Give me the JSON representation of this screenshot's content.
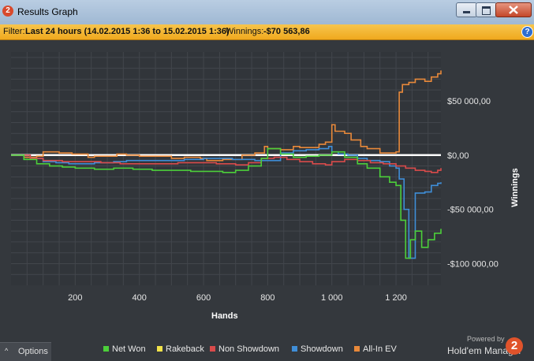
{
  "window": {
    "title": "Results Graph",
    "app_icon_glyph": "2"
  },
  "filter": {
    "label": "Filter:",
    "value": "Last 24 hours (14.02.2015 1:36 to 15.02.2015 1:36)",
    "winnings_label": "Winnings:",
    "winnings_value": "-$70 563,86",
    "help_glyph": "?"
  },
  "chart_data": {
    "type": "line",
    "xlabel": "Hands",
    "ylabel": "Winnings",
    "xlim": [
      0,
      1340
    ],
    "ylim": [
      -120000,
      95000
    ],
    "x_ticks": [
      {
        "value": 200,
        "label": "200"
      },
      {
        "value": 400,
        "label": "400"
      },
      {
        "value": 600,
        "label": "600"
      },
      {
        "value": 800,
        "label": "800"
      },
      {
        "value": 1000,
        "label": "1 000"
      },
      {
        "value": 1200,
        "label": "1 200"
      }
    ],
    "y_ticks": [
      {
        "value": 50000,
        "label": "$50 000,00"
      },
      {
        "value": 0,
        "label": "$0,00"
      },
      {
        "value": -50000,
        "label": "-$50 000,00"
      },
      {
        "value": -100000,
        "label": "-$100 000,00"
      }
    ],
    "grid": true,
    "legend_position": "bottom",
    "series": [
      {
        "name": "Rakeback",
        "color": "#f2e34a",
        "x": [
          0,
          1340
        ],
        "y": [
          0,
          0
        ]
      },
      {
        "name": "All-In EV",
        "color": "#e8893a",
        "x": [
          0,
          40,
          80,
          100,
          150,
          190,
          240,
          260,
          310,
          330,
          360,
          400,
          450,
          500,
          540,
          590,
          610,
          660,
          700,
          720,
          760,
          790,
          800,
          840,
          880,
          900,
          960,
          980,
          1000,
          1010,
          1040,
          1060,
          1090,
          1110,
          1150,
          1190,
          1200,
          1210,
          1220,
          1240,
          1260,
          1290,
          1310,
          1330,
          1340
        ],
        "y": [
          0,
          -2000,
          -1000,
          3000,
          2000,
          1000,
          -2000,
          -1000,
          -1000,
          1000,
          0,
          -1000,
          -1000,
          -3000,
          -2000,
          -3000,
          -5000,
          -4000,
          -4000,
          0,
          2000,
          8000,
          6000,
          5000,
          8000,
          7000,
          10000,
          12000,
          28000,
          22000,
          20000,
          14000,
          8000,
          6000,
          2000,
          2000,
          3000,
          58000,
          65000,
          67000,
          70000,
          68000,
          72000,
          75000,
          78000
        ]
      },
      {
        "name": "Showdown",
        "color": "#3f8ed8",
        "x": [
          0,
          60,
          100,
          140,
          180,
          220,
          260,
          290,
          320,
          360,
          400,
          450,
          500,
          540,
          600,
          640,
          690,
          720,
          760,
          800,
          840,
          880,
          920,
          960,
          990,
          1000,
          1020,
          1050,
          1080,
          1110,
          1150,
          1180,
          1200,
          1210,
          1225,
          1240,
          1260,
          1290,
          1310,
          1330,
          1340
        ],
        "y": [
          0,
          -3000,
          -6000,
          -7000,
          -8000,
          -8000,
          -7000,
          -7000,
          -6000,
          -5000,
          -5000,
          -5000,
          -5000,
          -4000,
          -3000,
          -3000,
          -4000,
          -4000,
          -5000,
          -5000,
          2000,
          4000,
          5000,
          6000,
          8000,
          3000,
          1000,
          0,
          -3000,
          -5000,
          -6000,
          -10000,
          -12000,
          -22000,
          -50000,
          -95000,
          -35000,
          -34000,
          -28000,
          -26000,
          -25000
        ]
      },
      {
        "name": "Non Showdown",
        "color": "#d94b4b",
        "x": [
          0,
          60,
          100,
          160,
          220,
          280,
          340,
          400,
          460,
          520,
          580,
          640,
          700,
          740,
          780,
          820,
          860,
          900,
          940,
          980,
          1000,
          1040,
          1080,
          1120,
          1160,
          1200,
          1230,
          1260,
          1290,
          1310,
          1330,
          1340
        ],
        "y": [
          0,
          -3000,
          -5000,
          -6000,
          -6000,
          -7000,
          -8000,
          -8000,
          -8000,
          -7000,
          -7000,
          -8000,
          -9000,
          -7000,
          -3000,
          -2000,
          -4000,
          -6000,
          -8000,
          -9000,
          -6000,
          -4000,
          -5000,
          -7000,
          -8000,
          -10000,
          -12000,
          -14000,
          -15000,
          -16000,
          -14000,
          -12000
        ]
      },
      {
        "name": "Net Won",
        "color": "#4ccf3a",
        "x": [
          0,
          40,
          80,
          120,
          160,
          200,
          260,
          320,
          380,
          440,
          500,
          560,
          620,
          660,
          700,
          740,
          780,
          800,
          840,
          880,
          920,
          960,
          1000,
          1040,
          1080,
          1110,
          1150,
          1180,
          1200,
          1215,
          1230,
          1245,
          1260,
          1280,
          1300,
          1320,
          1340
        ],
        "y": [
          0,
          -4000,
          -8000,
          -10000,
          -11000,
          -12000,
          -13000,
          -12000,
          -13000,
          -14000,
          -14000,
          -15000,
          -15000,
          -16000,
          -14000,
          -10000,
          -3000,
          6000,
          1000,
          -2000,
          -1000,
          0,
          3000,
          -2000,
          -8000,
          -12000,
          -20000,
          -25000,
          -28000,
          -60000,
          -95000,
          -78000,
          -70000,
          -85000,
          -78000,
          -72000,
          -68000
        ]
      }
    ]
  },
  "legend": [
    {
      "label": "Net Won",
      "color": "#4ccf3a"
    },
    {
      "label": "Rakeback",
      "color": "#f2e34a"
    },
    {
      "label": "Non Showdown",
      "color": "#d94b4b"
    },
    {
      "label": "Showdown",
      "color": "#3f8ed8"
    },
    {
      "label": "All-In EV",
      "color": "#e8893a"
    }
  ],
  "options": {
    "label": "Options",
    "caret": "^"
  },
  "branding": {
    "powered": "Powered by",
    "product": "Hold'em Manager",
    "logo_glyph": "2",
    "logo_color": "#e0532b"
  }
}
